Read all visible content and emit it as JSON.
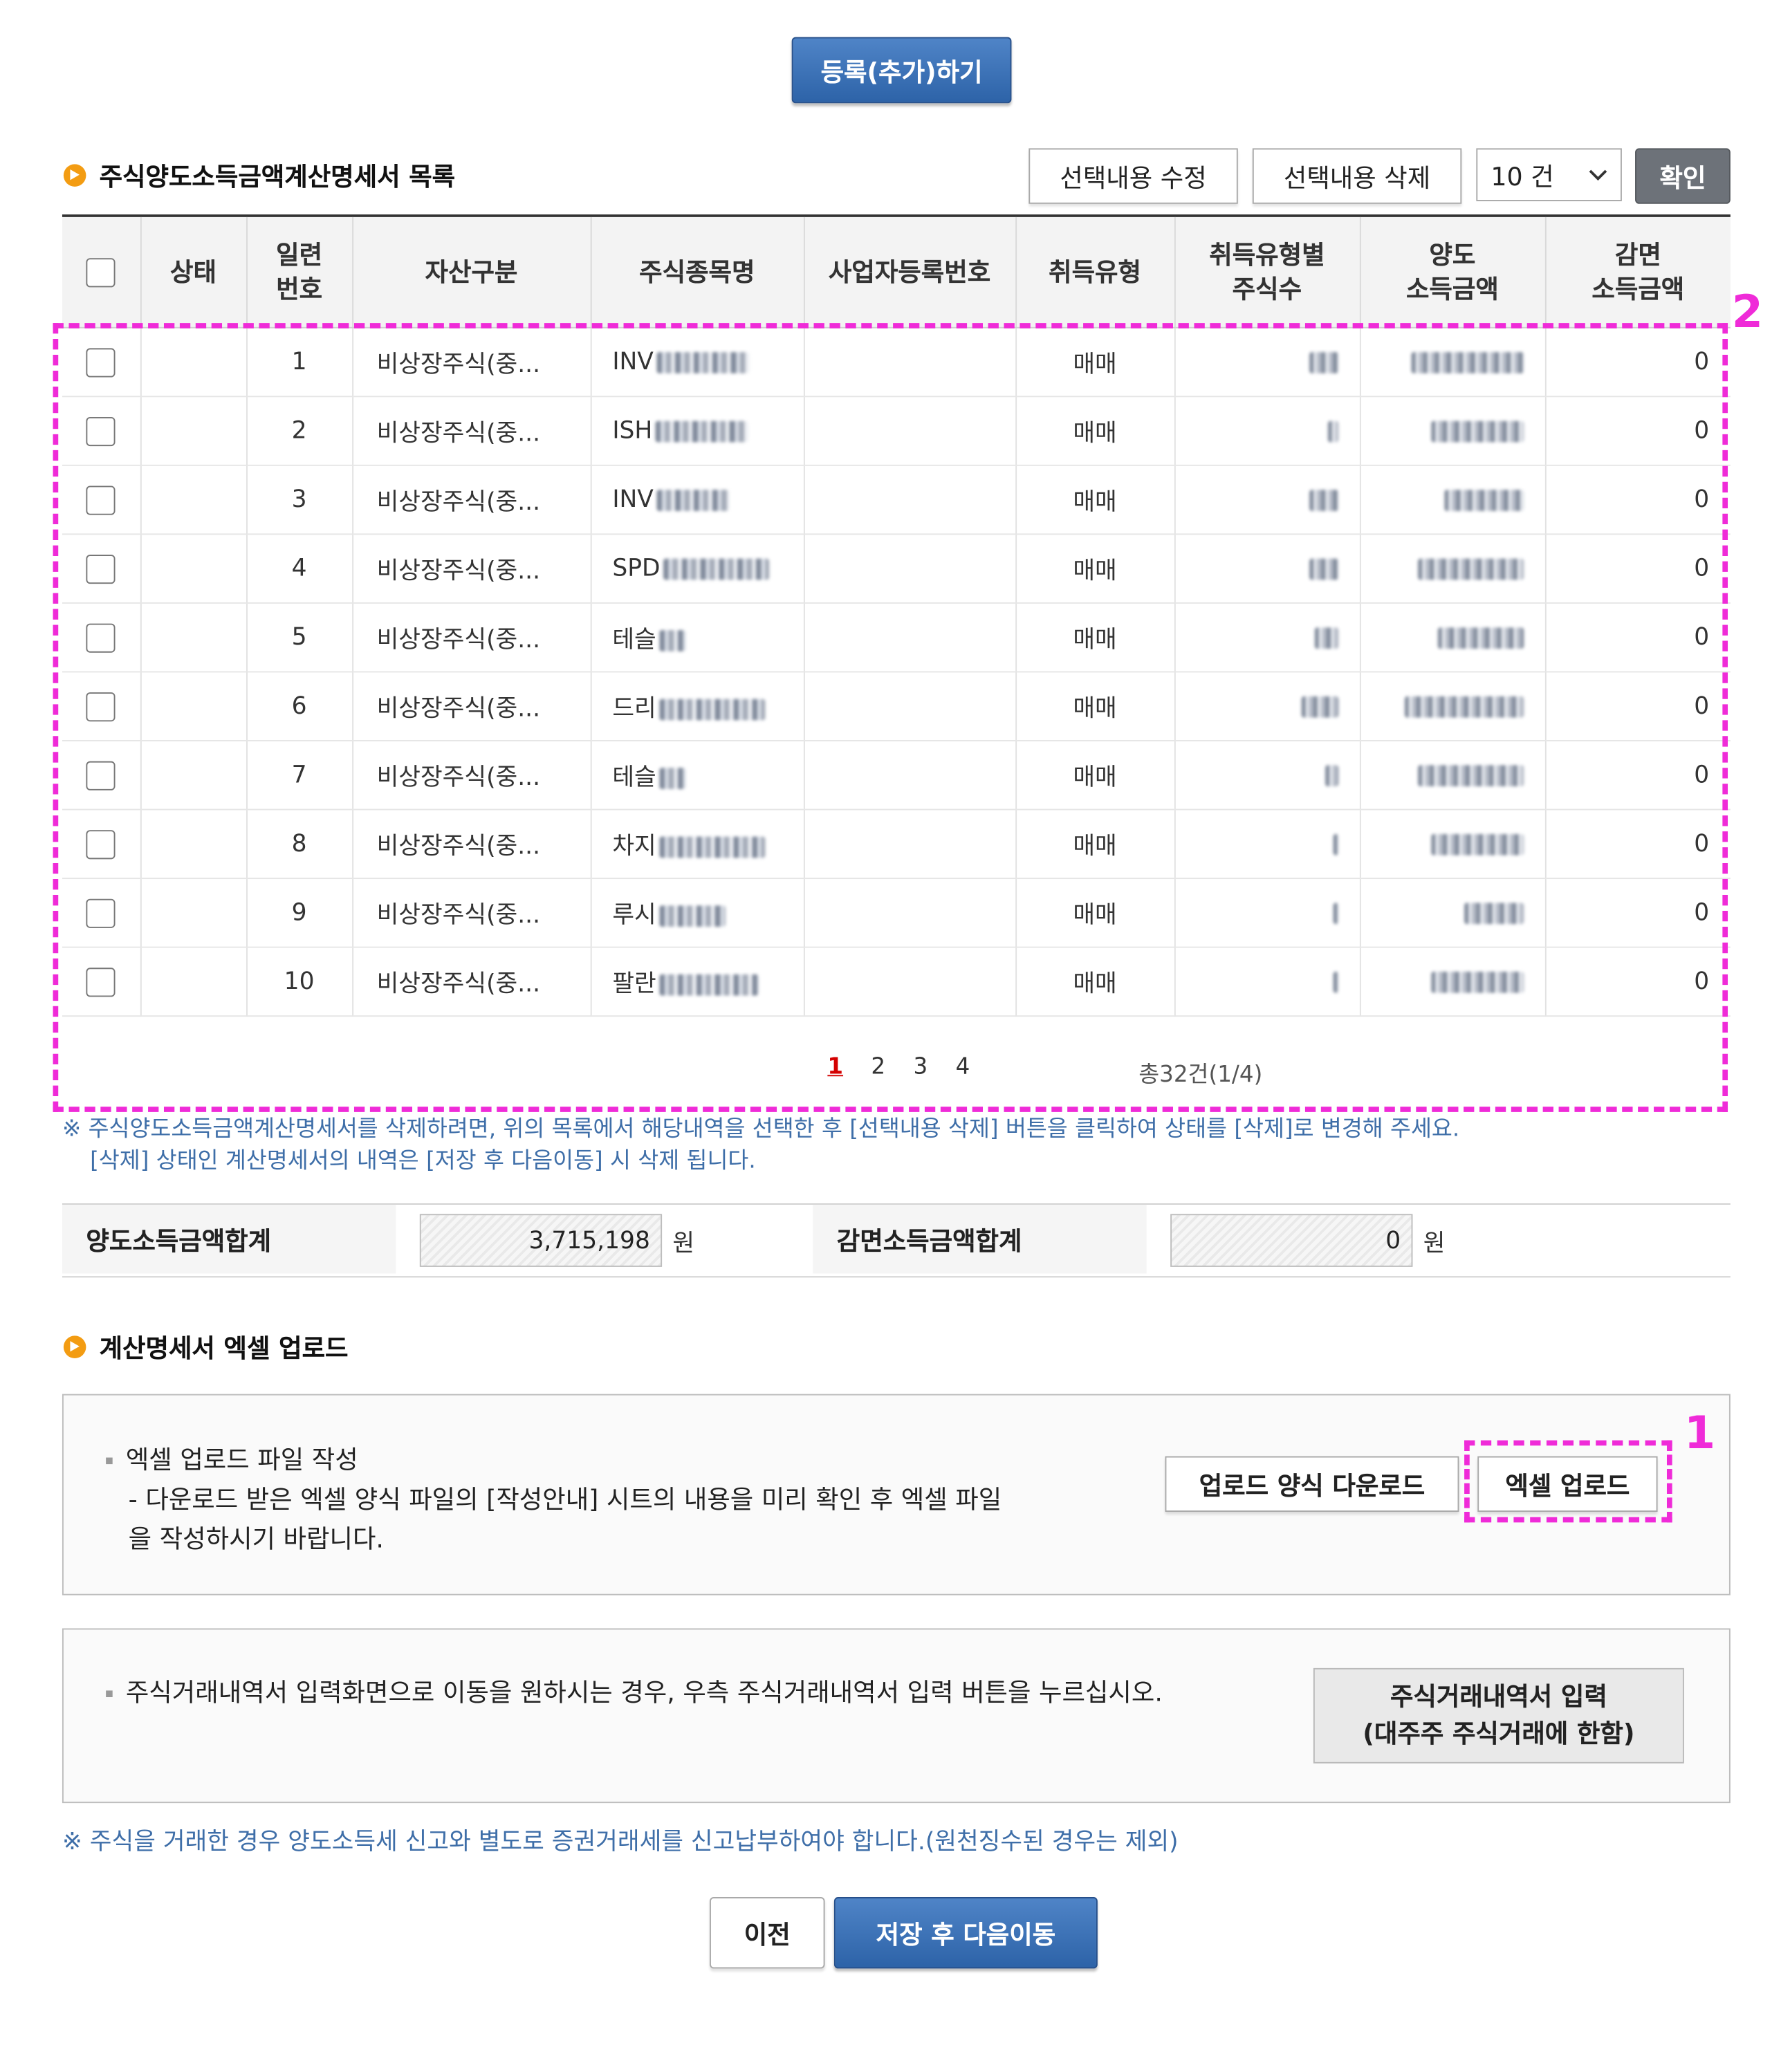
{
  "top_button": "등록(추가)하기",
  "list_section": {
    "title": "주식양도소득금액계산명세서 목록",
    "edit_button": "선택내용 수정",
    "delete_button": "선택내용 삭제",
    "page_size_select": "10 건",
    "confirm_button": "확인"
  },
  "table": {
    "headers": {
      "status": "상태",
      "seq": [
        "일련",
        "번호"
      ],
      "asset_type": "자산구분",
      "stock_name": "주식종목명",
      "biz_no": "사업자등록번호",
      "acq_type": "취득유형",
      "shares": [
        "취득유형별",
        "주식수"
      ],
      "gain": [
        "양도",
        "소득금액"
      ],
      "exempt": [
        "감면",
        "소득금액"
      ]
    },
    "rows": [
      {
        "seq": "1",
        "asset": "비상장주식(중...",
        "name": "INV",
        "acq": "매매",
        "exempt": "0"
      },
      {
        "seq": "2",
        "asset": "비상장주식(중...",
        "name": "ISH",
        "acq": "매매",
        "exempt": "0"
      },
      {
        "seq": "3",
        "asset": "비상장주식(중...",
        "name": "INV",
        "acq": "매매",
        "exempt": "0"
      },
      {
        "seq": "4",
        "asset": "비상장주식(중...",
        "name": "SPD",
        "acq": "매매",
        "exempt": "0"
      },
      {
        "seq": "5",
        "asset": "비상장주식(중...",
        "name": "테슬",
        "acq": "매매",
        "exempt": "0"
      },
      {
        "seq": "6",
        "asset": "비상장주식(중...",
        "name": "드리",
        "acq": "매매",
        "exempt": "0"
      },
      {
        "seq": "7",
        "asset": "비상장주식(중...",
        "name": "테슬",
        "acq": "매매",
        "exempt": "0"
      },
      {
        "seq": "8",
        "asset": "비상장주식(중...",
        "name": "차지",
        "acq": "매매",
        "exempt": "0"
      },
      {
        "seq": "9",
        "asset": "비상장주식(중...",
        "name": "루시",
        "acq": "매매",
        "exempt": "0"
      },
      {
        "seq": "10",
        "asset": "비상장주식(중...",
        "name": "팔란",
        "acq": "매매",
        "exempt": "0"
      }
    ]
  },
  "pagination": {
    "pages": [
      "1",
      "2",
      "3",
      "4"
    ],
    "current": "1",
    "total": "총32건(1/4)"
  },
  "notes": {
    "delete_note_1": "※ 주식양도소득금액계산명세서를 삭제하려면, 위의 목록에서 해당내역을 선택한 후 [선택내용 삭제] 버튼을 클릭하여 상태를 [삭제]로 변경해 주세요.",
    "delete_note_2": "[삭제] 상태인 계산명세서의 내역은 [저장 후 다음이동] 시 삭제 됩니다."
  },
  "summary": {
    "gain_label": "양도소득금액합계",
    "gain_value": "3,715,198",
    "exempt_label": "감면소득금액합계",
    "exempt_value": "0",
    "unit": "원"
  },
  "excel_section": {
    "title": "계산명세서 엑셀 업로드",
    "bullet_title": "엑셀 업로드 파일 작성",
    "desc_line1": "- 다운로드 받은 엑셀 양식 파일의 [작성안내] 시트의 내용을 미리 확인 후 엑셀 파일",
    "desc_line2": "을 작성하시기 바랍니다.",
    "download_button": "업로드 양식 다운로드",
    "upload_button": "엑셀 업로드"
  },
  "trade_section": {
    "text": "주식거래내역서 입력화면으로 이동을 원하시는 경우, 우측 주식거래내역서 입력 버튼을 누르십시오.",
    "button_line1": "주식거래내역서 입력",
    "button_line2": "(대주주 주식거래에 한함)"
  },
  "bottom_note": "※ 주식을 거래한 경우 양도소득세 신고와 별도로 증권거래세를 신고납부하여야 합니다.(원천징수된 경우는 제외)",
  "nav": {
    "prev_button": "이전",
    "next_button": "저장 후 다음이동"
  },
  "annotations": {
    "mark_1": "1",
    "mark_2": "2"
  },
  "colors": {
    "primary_blue": "#2d63a8",
    "annotation_magenta": "#ef2bd8",
    "note_blue": "#3e6ea8",
    "bullet_orange": "#f39c12"
  }
}
